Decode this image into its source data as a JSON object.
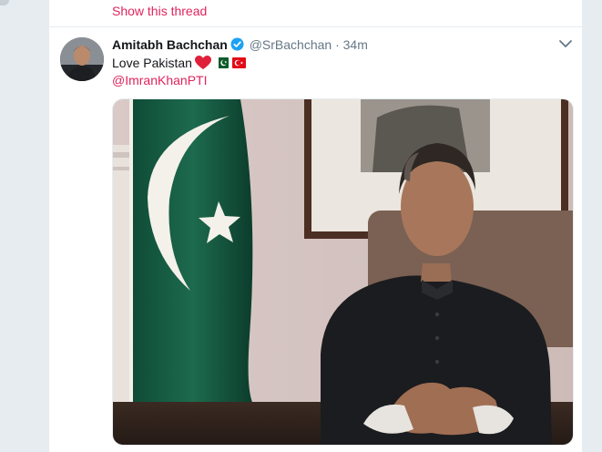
{
  "thread": {
    "show_label": "Show this thread"
  },
  "tweet": {
    "author_name": "Amitabh Bachchan",
    "handle": "@SrBachchan",
    "separator": "·",
    "time": "34m",
    "text": "Love Pakistan",
    "mention": "@ImranKhanPTI",
    "emoji": [
      "red-heart-icon",
      "pakistan-flag-icon",
      "turkey-flag-icon"
    ]
  },
  "colors": {
    "link": "#e0245e",
    "verified": "#1da1f2",
    "muted": "#657786"
  }
}
